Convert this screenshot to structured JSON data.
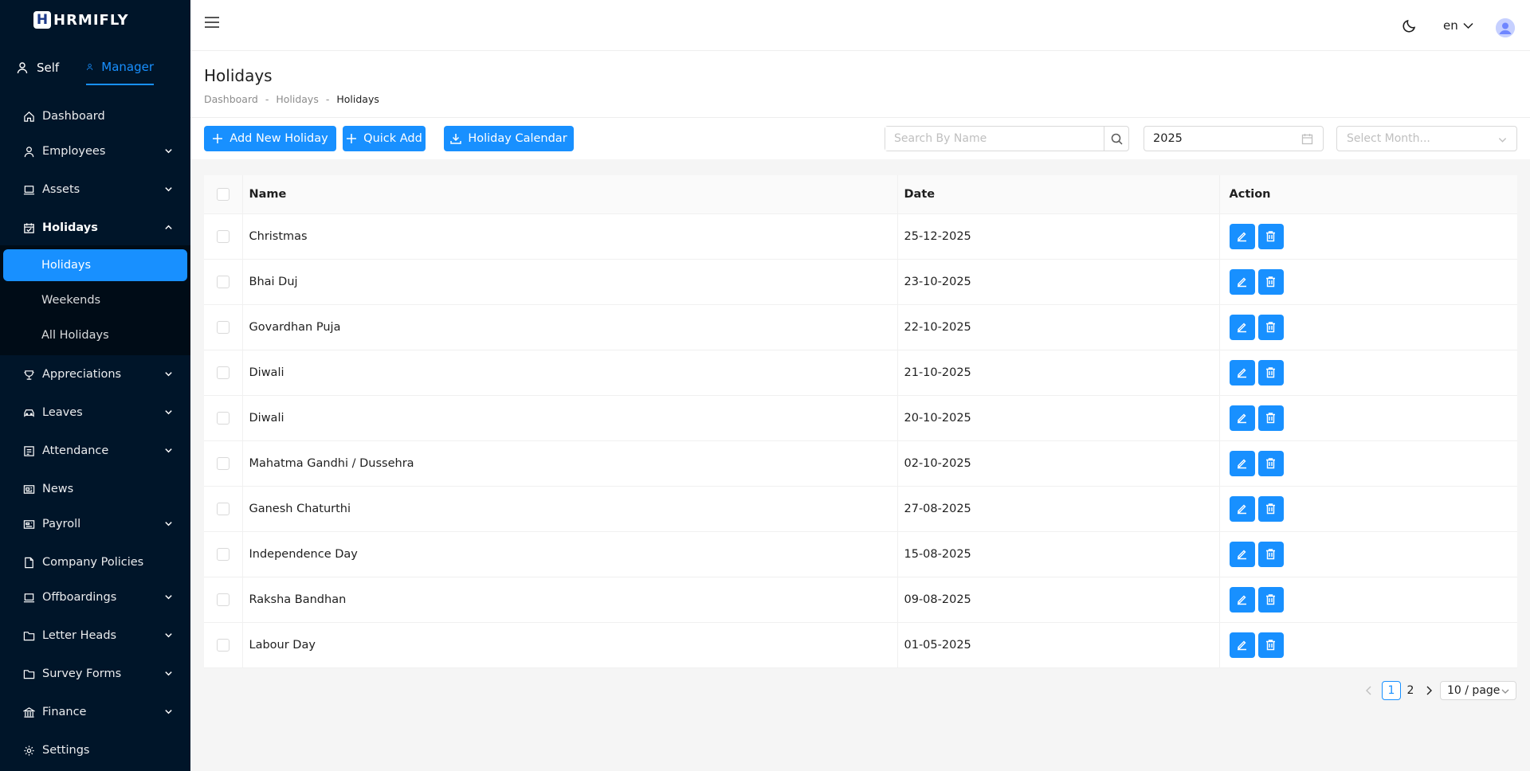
{
  "brand": {
    "logo_letter": "H",
    "name": "HRMIFLY"
  },
  "roles": {
    "self": "Self",
    "manager": "Manager"
  },
  "menu": [
    {
      "label": "Dashboard",
      "icon": "home-icon"
    },
    {
      "label": "Employees",
      "icon": "user-icon"
    },
    {
      "label": "Assets",
      "icon": "laptop-icon"
    },
    {
      "label": "Holidays",
      "icon": "calendar-icon"
    },
    {
      "label": "Appreciations",
      "icon": "trophy-icon"
    },
    {
      "label": "Leaves",
      "icon": "car-icon"
    },
    {
      "label": "Attendance",
      "icon": "form-icon"
    },
    {
      "label": "News",
      "icon": "news-icon"
    },
    {
      "label": "Payroll",
      "icon": "wallet-icon"
    },
    {
      "label": "Company Policies",
      "icon": "file-icon"
    },
    {
      "label": "Offboardings",
      "icon": "laptop-icon"
    },
    {
      "label": "Letter Heads",
      "icon": "folder-icon"
    },
    {
      "label": "Survey Forms",
      "icon": "folder-icon"
    },
    {
      "label": "Finance",
      "icon": "bank-icon"
    },
    {
      "label": "Settings",
      "icon": "gear-icon"
    }
  ],
  "submenu": [
    "Holidays",
    "Weekends",
    "All Holidays"
  ],
  "header": {
    "lang": "en"
  },
  "page": {
    "title": "Holidays",
    "breadcrumb": [
      "Dashboard",
      "Holidays",
      "Holidays"
    ],
    "separator": "-"
  },
  "toolbar": {
    "add_label": "Add New Holiday",
    "quick_add_label": "Quick Add",
    "calendar_label": "Holiday Calendar",
    "search_placeholder": "Search By Name",
    "year": "2025",
    "month_placeholder": "Select Month..."
  },
  "table": {
    "columns": [
      "Name",
      "Date",
      "Action"
    ],
    "rows": [
      {
        "name": "Christmas",
        "date": "25-12-2025"
      },
      {
        "name": "Bhai Duj",
        "date": "23-10-2025"
      },
      {
        "name": "Govardhan Puja",
        "date": "22-10-2025"
      },
      {
        "name": "Diwali",
        "date": "21-10-2025"
      },
      {
        "name": "Diwali",
        "date": "20-10-2025"
      },
      {
        "name": "Mahatma Gandhi / Dussehra",
        "date": "02-10-2025"
      },
      {
        "name": "Ganesh Chaturthi",
        "date": "27-08-2025"
      },
      {
        "name": "Independence Day",
        "date": "15-08-2025"
      },
      {
        "name": "Raksha Bandhan",
        "date": "09-08-2025"
      },
      {
        "name": "Labour Day",
        "date": "01-05-2025"
      }
    ]
  },
  "pagination": {
    "pages": [
      "1",
      "2"
    ],
    "current": "1",
    "page_size": "10 / page"
  },
  "colors": {
    "sidebar": "#001529",
    "submenu": "#000c17",
    "accent": "#1890ff"
  }
}
